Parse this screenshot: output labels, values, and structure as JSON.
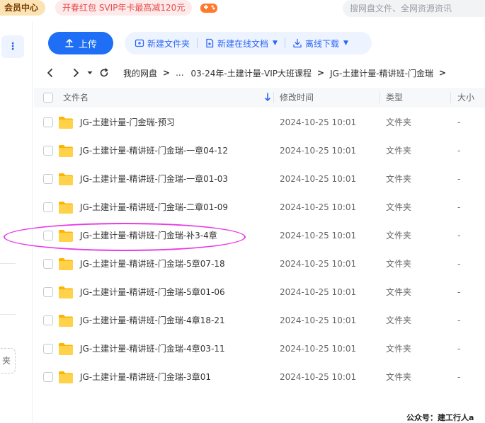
{
  "topbar": {
    "vip_label": "会员中心",
    "promo_text": "开春红包 SVIP年卡最高减120元",
    "search_placeholder": "搜网盘文件、全网资源资讯"
  },
  "sidebar": {
    "more_glyph": "⋮",
    "button_fragment": "夹"
  },
  "toolbar": {
    "upload_label": "上传",
    "new_folder_label": "新建文件夹",
    "new_doc_label": "新建在线文档",
    "offline_download_label": "离线下载"
  },
  "breadcrumb": {
    "root": "我的网盘",
    "ellipsis": "...",
    "parent": "03-24年-土建计量-VIP大班课程",
    "current": "JG-土建计量-精讲班-门金瑞"
  },
  "table": {
    "headers": {
      "name": "文件名",
      "modified": "修改时间",
      "type": "类型",
      "size": "大小"
    },
    "rows": [
      {
        "name": "JG-土建计量-门金瑞-预习",
        "time": "2024-10-25 10:01",
        "type": "文件夹",
        "size": "-"
      },
      {
        "name": "JG-土建计量-精讲班-门金瑞-一章04-12",
        "time": "2024-10-25 10:01",
        "type": "文件夹",
        "size": "-"
      },
      {
        "name": "JG-土建计量-精讲班-门金瑞-一章01-03",
        "time": "2024-10-25 10:01",
        "type": "文件夹",
        "size": "-"
      },
      {
        "name": "JG-土建计量-精讲班-门金瑞-二章01-09",
        "time": "2024-10-25 10:01",
        "type": "文件夹",
        "size": "-"
      },
      {
        "name": "JG-土建计量-精讲班-门金瑞-补3-4章",
        "time": "2024-10-25 10:01",
        "type": "文件夹",
        "size": "-"
      },
      {
        "name": "JG-土建计量-精讲班-门金瑞-5章07-18",
        "time": "2024-10-25 10:01",
        "type": "文件夹",
        "size": "-"
      },
      {
        "name": "JG-土建计量-精讲班-门金瑞-5章01-06",
        "time": "2024-10-25 10:01",
        "type": "文件夹",
        "size": "-"
      },
      {
        "name": "JG-土建计量-精讲班-门金瑞-4章18-21",
        "time": "2024-10-25 10:01",
        "type": "文件夹",
        "size": "-"
      },
      {
        "name": "JG-土建计量-精讲班-门金瑞-4章03-11",
        "time": "2024-10-25 10:01",
        "type": "文件夹",
        "size": "-"
      },
      {
        "name": "JG-土建计量-精讲班-门金瑞-3章01",
        "time": "2024-10-25 10:01",
        "type": "文件夹",
        "size": "-"
      }
    ]
  },
  "watermark": "公众号：建工行人a",
  "colors": {
    "accent": "#1e6ff5",
    "folder": "#ffc93c",
    "highlight": "#e83be6"
  }
}
